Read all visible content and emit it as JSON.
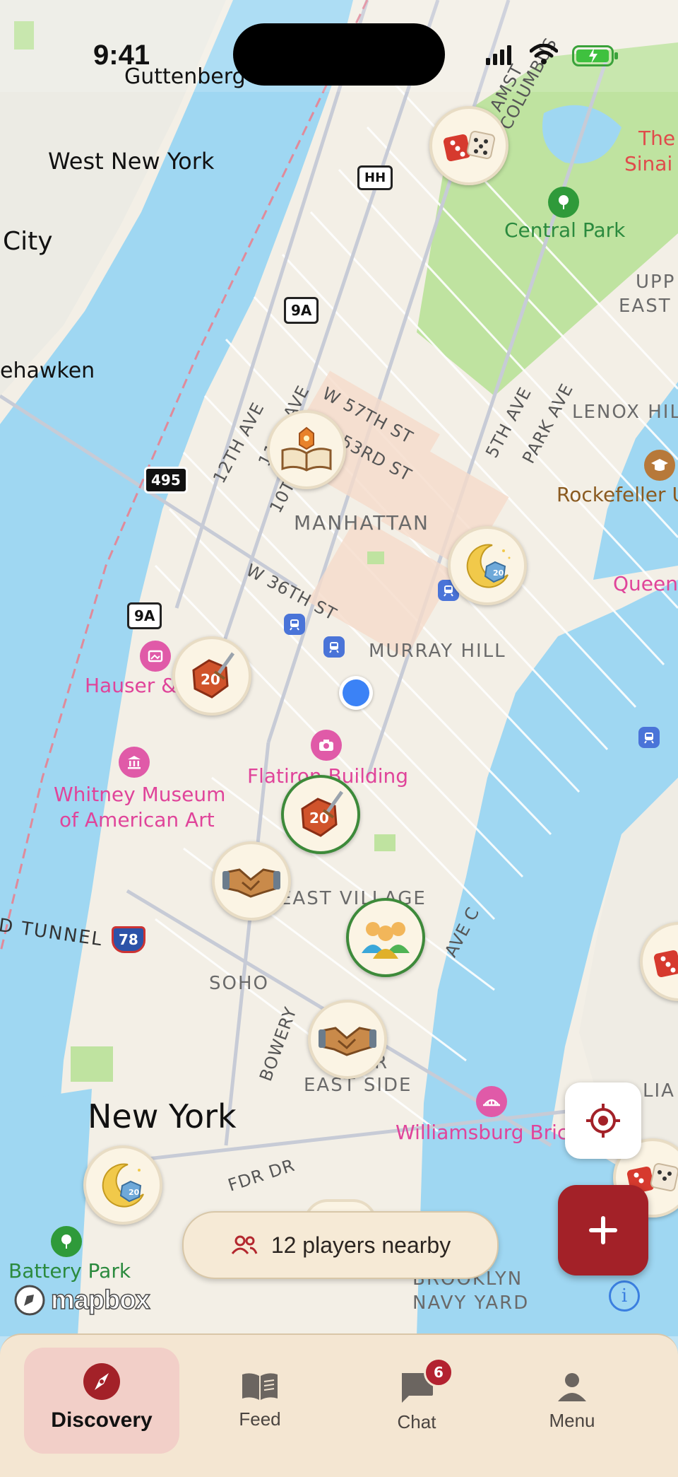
{
  "status_bar": {
    "time": "9:41"
  },
  "map": {
    "places": {
      "guttenberg": "Guttenberg",
      "west_new_york": "West New York",
      "city": "City",
      "weehawken": "ehawken",
      "central_park": "Central Park",
      "the_sinai_1": "The",
      "the_sinai_2": "Sinai",
      "upper_east_1": "UPP",
      "upper_east_2": "EAST S",
      "lenox_hill": "LENOX HILL",
      "rockefeller": "Rockefeller U",
      "manhattan": "MANHATTAN",
      "queens": "Queens",
      "murray_hill": "MURRAY HILL",
      "hauser": "Hauser &",
      "whitney_1": "Whitney Museum",
      "whitney_2": "of American Art",
      "flatiron": "Flatiron Building",
      "east_village": "EAST VILLAGE",
      "soho": "SOHO",
      "east_side_1": "R",
      "east_side_2": "EAST SIDE",
      "new_york": "New York",
      "williamsburg": "Williamsburg Bric",
      "battery_park": "Battery Park",
      "brooklyn_navy_1": "BROOKLYN",
      "brooklyn_navy_2": "NAVY YARD",
      "lia": "LIA",
      "tunnel": "D TUNNEL"
    },
    "streets": {
      "w57": "W 57TH ST",
      "w53": "W 53RD ST",
      "w36": "W 36TH ST",
      "ave12": "12TH AVE",
      "ave11": "11TH AVE",
      "ave10": "10T",
      "ave5": "5TH AVE",
      "park_ave": "PARK AVE",
      "columbus": "COLUMBUS",
      "amst": "AMST",
      "bowery": "BOWERY",
      "ave_c": "AVE C",
      "fdr": "FDR DR",
      "ave_r": "AVE",
      "park_ave_s": "PARK AVE"
    },
    "shields": {
      "hh": "HH",
      "r9a_top": "9A",
      "r495": "495",
      "r9a_mid": "9A",
      "i78": "78"
    },
    "markers": [
      {
        "name": "dice-marker",
        "icon": "dice-icon",
        "active": false
      },
      {
        "name": "book-marker",
        "icon": "spellbook-icon",
        "active": false
      },
      {
        "name": "moon-marker",
        "icon": "moon-d20-icon",
        "active": false
      },
      {
        "name": "d20-sword-marker",
        "icon": "d20-sword-icon",
        "active": false
      },
      {
        "name": "d20-sword-marker-active",
        "icon": "d20-sword-icon",
        "active": true
      },
      {
        "name": "handshake-marker",
        "icon": "handshake-icon",
        "active": false
      },
      {
        "name": "group-marker",
        "icon": "group-icon",
        "active": true
      },
      {
        "name": "handshake-marker-2",
        "icon": "handshake-icon",
        "active": false
      },
      {
        "name": "moon-marker-2",
        "icon": "moon-d20-icon",
        "active": false
      },
      {
        "name": "dice-marker-edge",
        "icon": "dice-icon",
        "active": false
      },
      {
        "name": "dice-marker-edge-2",
        "icon": "dice-icon",
        "active": false
      }
    ],
    "attribution": "mapbox",
    "info_label": "i"
  },
  "nearby": {
    "label": "12 players nearby",
    "icon": "people-icon"
  },
  "buttons": {
    "locate_icon": "crosshair-icon",
    "add_label": "+"
  },
  "tabs": [
    {
      "label": "Discovery",
      "icon": "compass-icon",
      "selected": true
    },
    {
      "label": "Feed",
      "icon": "book-icon",
      "selected": false
    },
    {
      "label": "Chat",
      "icon": "chat-icon",
      "selected": false,
      "badge": "6"
    },
    {
      "label": "Menu",
      "icon": "person-icon",
      "selected": false
    }
  ],
  "colors": {
    "accent": "#a32128",
    "water": "#9fd7f2",
    "land": "#f3efe6",
    "park": "#bfe3a0",
    "tabbar": "#f4e6d2"
  }
}
